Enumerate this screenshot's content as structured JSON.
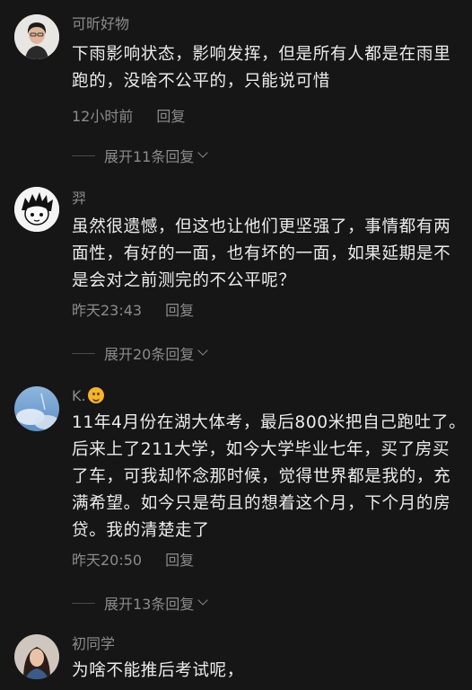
{
  "comments": [
    {
      "username": "可昕好物",
      "text": "下雨影响状态，影响发挥，但是所有人都是在雨里跑的，没啥不公平的，只能说可惜",
      "time": "12小时前",
      "reply_label": "回复",
      "expand_label": "展开11条回复"
    },
    {
      "username": "羿",
      "text": "虽然很遗憾，但这也让他们更坚强了，事情都有两面性，有好的一面，也有坏的一面，如果延期是不是会对之前测完的不公平呢？",
      "time": "昨天23:43",
      "reply_label": "回复",
      "expand_label": "展开20条回复"
    },
    {
      "username": "K.",
      "text": "11年4月份在湖大体考，最后800米把自己跑吐了。后来上了211大学，如今大学毕业七年，买了房买了车，可我却怀念那时候，觉得世界都是我的，充满希望。如今只是苟且的想着这个月，下个月的房贷。我的清楚走了",
      "time": "昨天20:50",
      "reply_label": "回复",
      "expand_label": "展开13条回复"
    },
    {
      "username": "初同学",
      "text": "为啥不能推后考试呢，"
    }
  ]
}
